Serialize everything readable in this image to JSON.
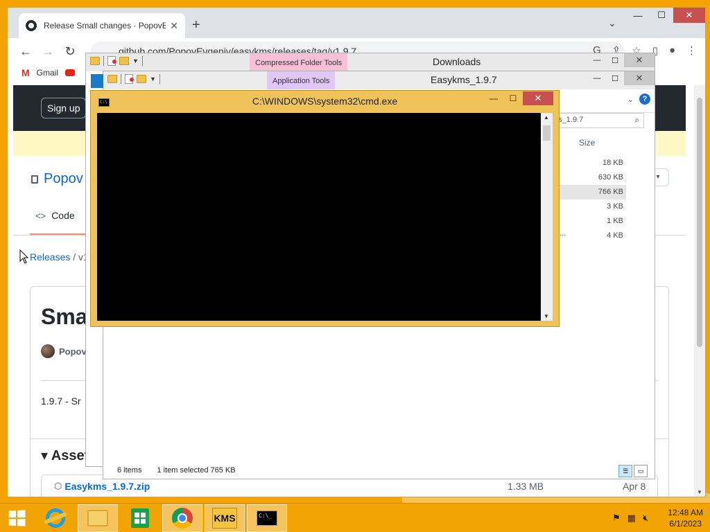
{
  "chrome": {
    "tab_title": "Release Small changes · PopovEv",
    "url": "github.com/PopovEvgeniy/easykms/releases/tag/v1.9.7",
    "bookmarks": [
      {
        "label": "Gmail"
      }
    ],
    "page": {
      "signup": "Sign up",
      "repo_owner": "Popov",
      "code_tab": "Code",
      "breadcrumb_releases": "Releases",
      "breadcrumb_sep": "/",
      "breadcrumb_tag": "v1",
      "release_title": "Sma",
      "author": "Popov",
      "release_body": "1.9.7 - Sr",
      "assets_heading": "Asset",
      "asset": {
        "name": "Easykms_1.9.7.zip",
        "size": "1.33 MB",
        "date": "Apr 8"
      }
    }
  },
  "explorer_downloads": {
    "ctx_tab": "Compressed Folder Tools",
    "title": "Downloads"
  },
  "explorer_easykms": {
    "ctx_tab": "Application Tools",
    "title": "Easykms_1.9.7",
    "search_text": "ms_1.9.7",
    "size_header": "Size",
    "sizes": [
      "18 KB",
      "630 KB",
      "766 KB",
      "3 KB",
      "1 KB",
      "4 KB"
    ],
    "selected_index": 2,
    "trunc_name": "o...",
    "status_items": "6 items",
    "status_selected": "1 item selected  765 KB"
  },
  "cmd": {
    "title": "C:\\WINDOWS\\system32\\cmd.exe"
  },
  "taskbar": {
    "kms_label": "KMS",
    "time": "12:48 AM",
    "date": "6/1/2023"
  }
}
